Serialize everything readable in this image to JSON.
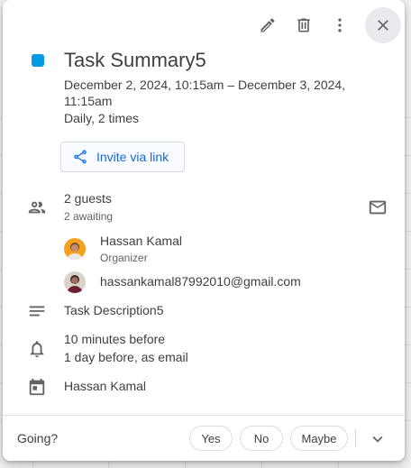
{
  "event": {
    "title": "Task Summary5",
    "when": "December 2, 2024, 10:15am – December 3, 2024, 11:15am",
    "recurrence": "Daily, 2 times",
    "color": "#039be5",
    "invite_label": "Invite via link",
    "guests_count": "2 guests",
    "guests_status": "2 awaiting",
    "guests": [
      {
        "name": "Hassan Kamal",
        "role": "Organizer"
      },
      {
        "name": "hassankamal87992010@gmail.com"
      }
    ],
    "description": "Task Description5",
    "notifications": [
      "10 minutes before",
      "1 day before, as email"
    ],
    "calendar_owner": "Hassan Kamal"
  },
  "toolbar": {
    "icons": [
      "edit-icon",
      "delete-icon",
      "more-options-icon",
      "close-icon"
    ]
  },
  "rsvp": {
    "prompt": "Going?",
    "yes": "Yes",
    "no": "No",
    "maybe": "Maybe"
  }
}
